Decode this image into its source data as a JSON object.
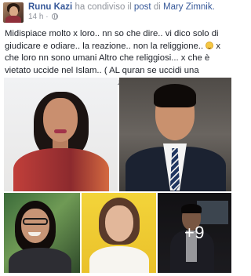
{
  "post": {
    "author": "Runu Kazi",
    "action_prefix": "ha condiviso il",
    "action_link": "post",
    "action_suffix": "di",
    "original_author": "Mary Zimnik.",
    "time": "14 h",
    "time_sep": "·",
    "text_parts": [
      "Midispiace molto x loro.. nn so che dire.. vi dico solo di giudicare e odiare.. la reazione.. non la religgione.. ",
      " x che loro nn sono umani Altro che religgiosi... x che è vietato uccide nel Islam.. ( AL quran se uccidi una persona e come se fosse ai ucciso tutta la umanita... ) nn saranno perdonati.. "
    ],
    "emoji_names": [
      "smile-emoji",
      "smile-emoji"
    ]
  },
  "photos": {
    "items": [
      {
        "name": "photo-woman-red-saree"
      },
      {
        "name": "photo-young-man-suit"
      },
      {
        "name": "photo-woman-glasses"
      },
      {
        "name": "photo-woman-yellow-background"
      },
      {
        "name": "photo-man-speaking"
      }
    ],
    "more_count": "+9"
  },
  "colors": {
    "link": "#365899",
    "muted": "#90949c",
    "text": "#1d2129"
  }
}
